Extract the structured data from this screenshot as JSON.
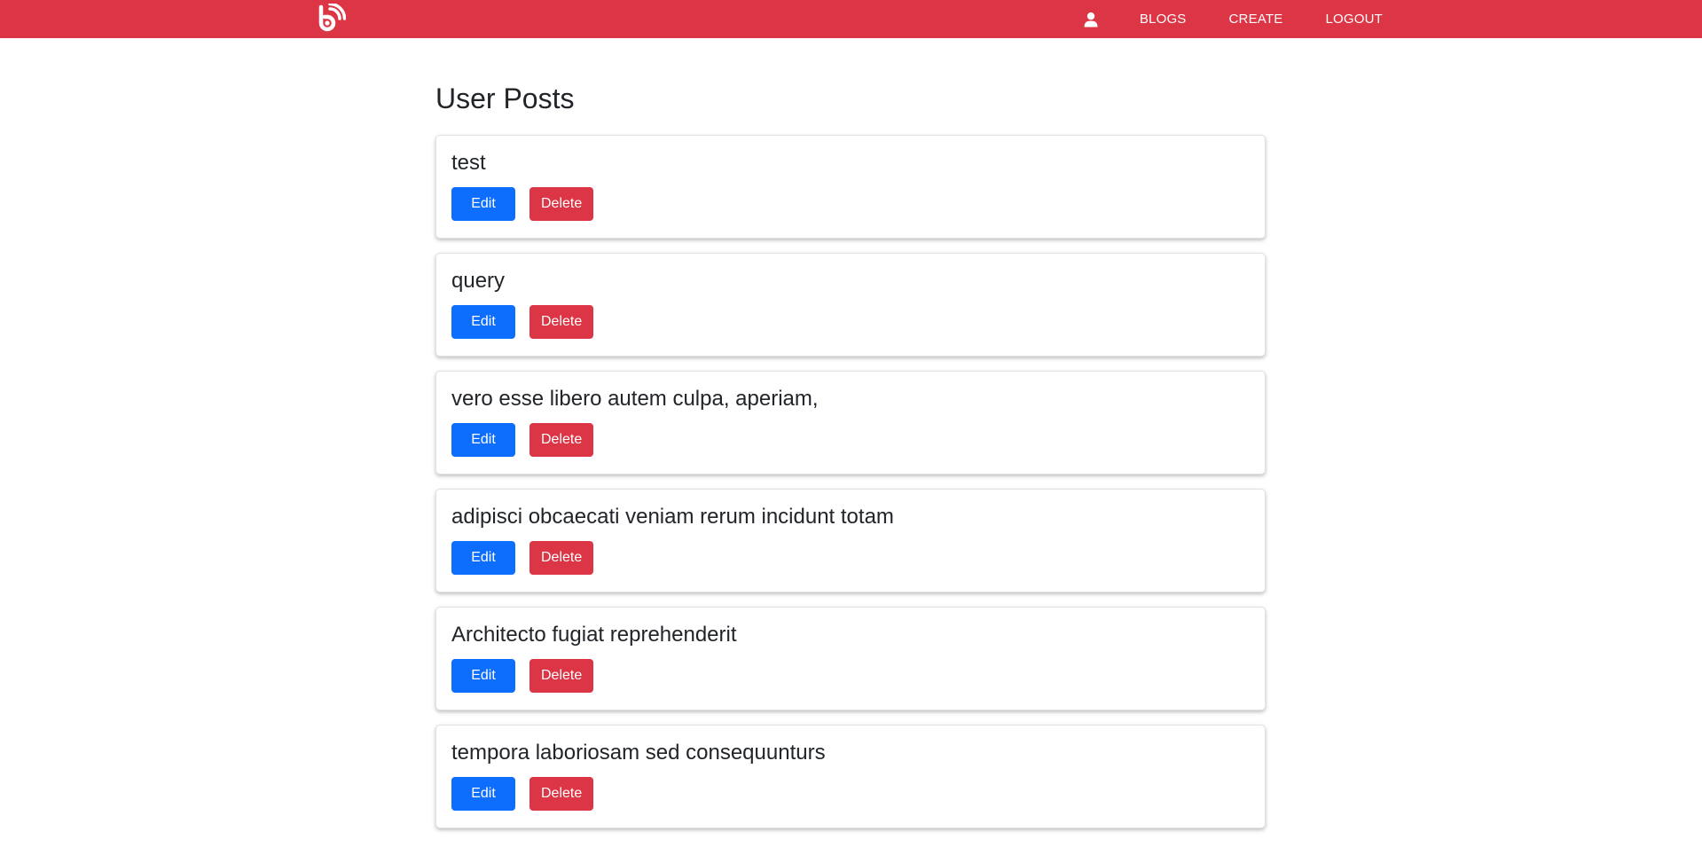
{
  "nav": {
    "brand_icon": "blog-rss-logo-icon",
    "user_icon": "user-icon",
    "links": [
      "BLOGS",
      "CREATE",
      "LOGOUT"
    ]
  },
  "page": {
    "title": "User Posts"
  },
  "posts": [
    {
      "title": "test",
      "edit_label": "Edit",
      "delete_label": "Delete"
    },
    {
      "title": "query",
      "edit_label": "Edit",
      "delete_label": "Delete"
    },
    {
      "title": "vero esse libero autem culpa, aperiam,",
      "edit_label": "Edit",
      "delete_label": "Delete"
    },
    {
      "title": "adipisci obcaecati veniam rerum incidunt totam",
      "edit_label": "Edit",
      "delete_label": "Delete"
    },
    {
      "title": "Architecto fugiat reprehenderit",
      "edit_label": "Edit",
      "delete_label": "Delete"
    },
    {
      "title": "tempora laboriosam sed consequunturs",
      "edit_label": "Edit",
      "delete_label": "Delete"
    }
  ],
  "colors": {
    "navbar": "#dc3545",
    "edit_button": "#0d6efd",
    "delete_button": "#dc3545"
  }
}
